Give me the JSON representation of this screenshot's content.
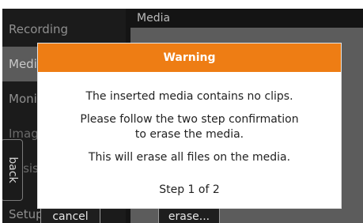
{
  "sidebar": {
    "items": [
      {
        "label": "Recording"
      },
      {
        "label": "Media"
      },
      {
        "label": "Monitor"
      },
      {
        "label": "Image"
      },
      {
        "label": "Assist"
      },
      {
        "label": "Setup"
      }
    ]
  },
  "panel": {
    "title": "Media"
  },
  "back_tab": {
    "label": "back"
  },
  "buttons": {
    "cancel_label": "cancel",
    "erase_label": "erase..."
  },
  "dialog": {
    "title": "Warning",
    "line1": "The inserted media contains no clips.",
    "line2a": "Please follow the two step confirmation",
    "line2b": "to erase the media.",
    "line3": "This will erase all files on the media.",
    "step": "Step 1 of 2"
  },
  "colors": {
    "accent": "#ee7d14",
    "selected_item": "#5b5b5b"
  }
}
